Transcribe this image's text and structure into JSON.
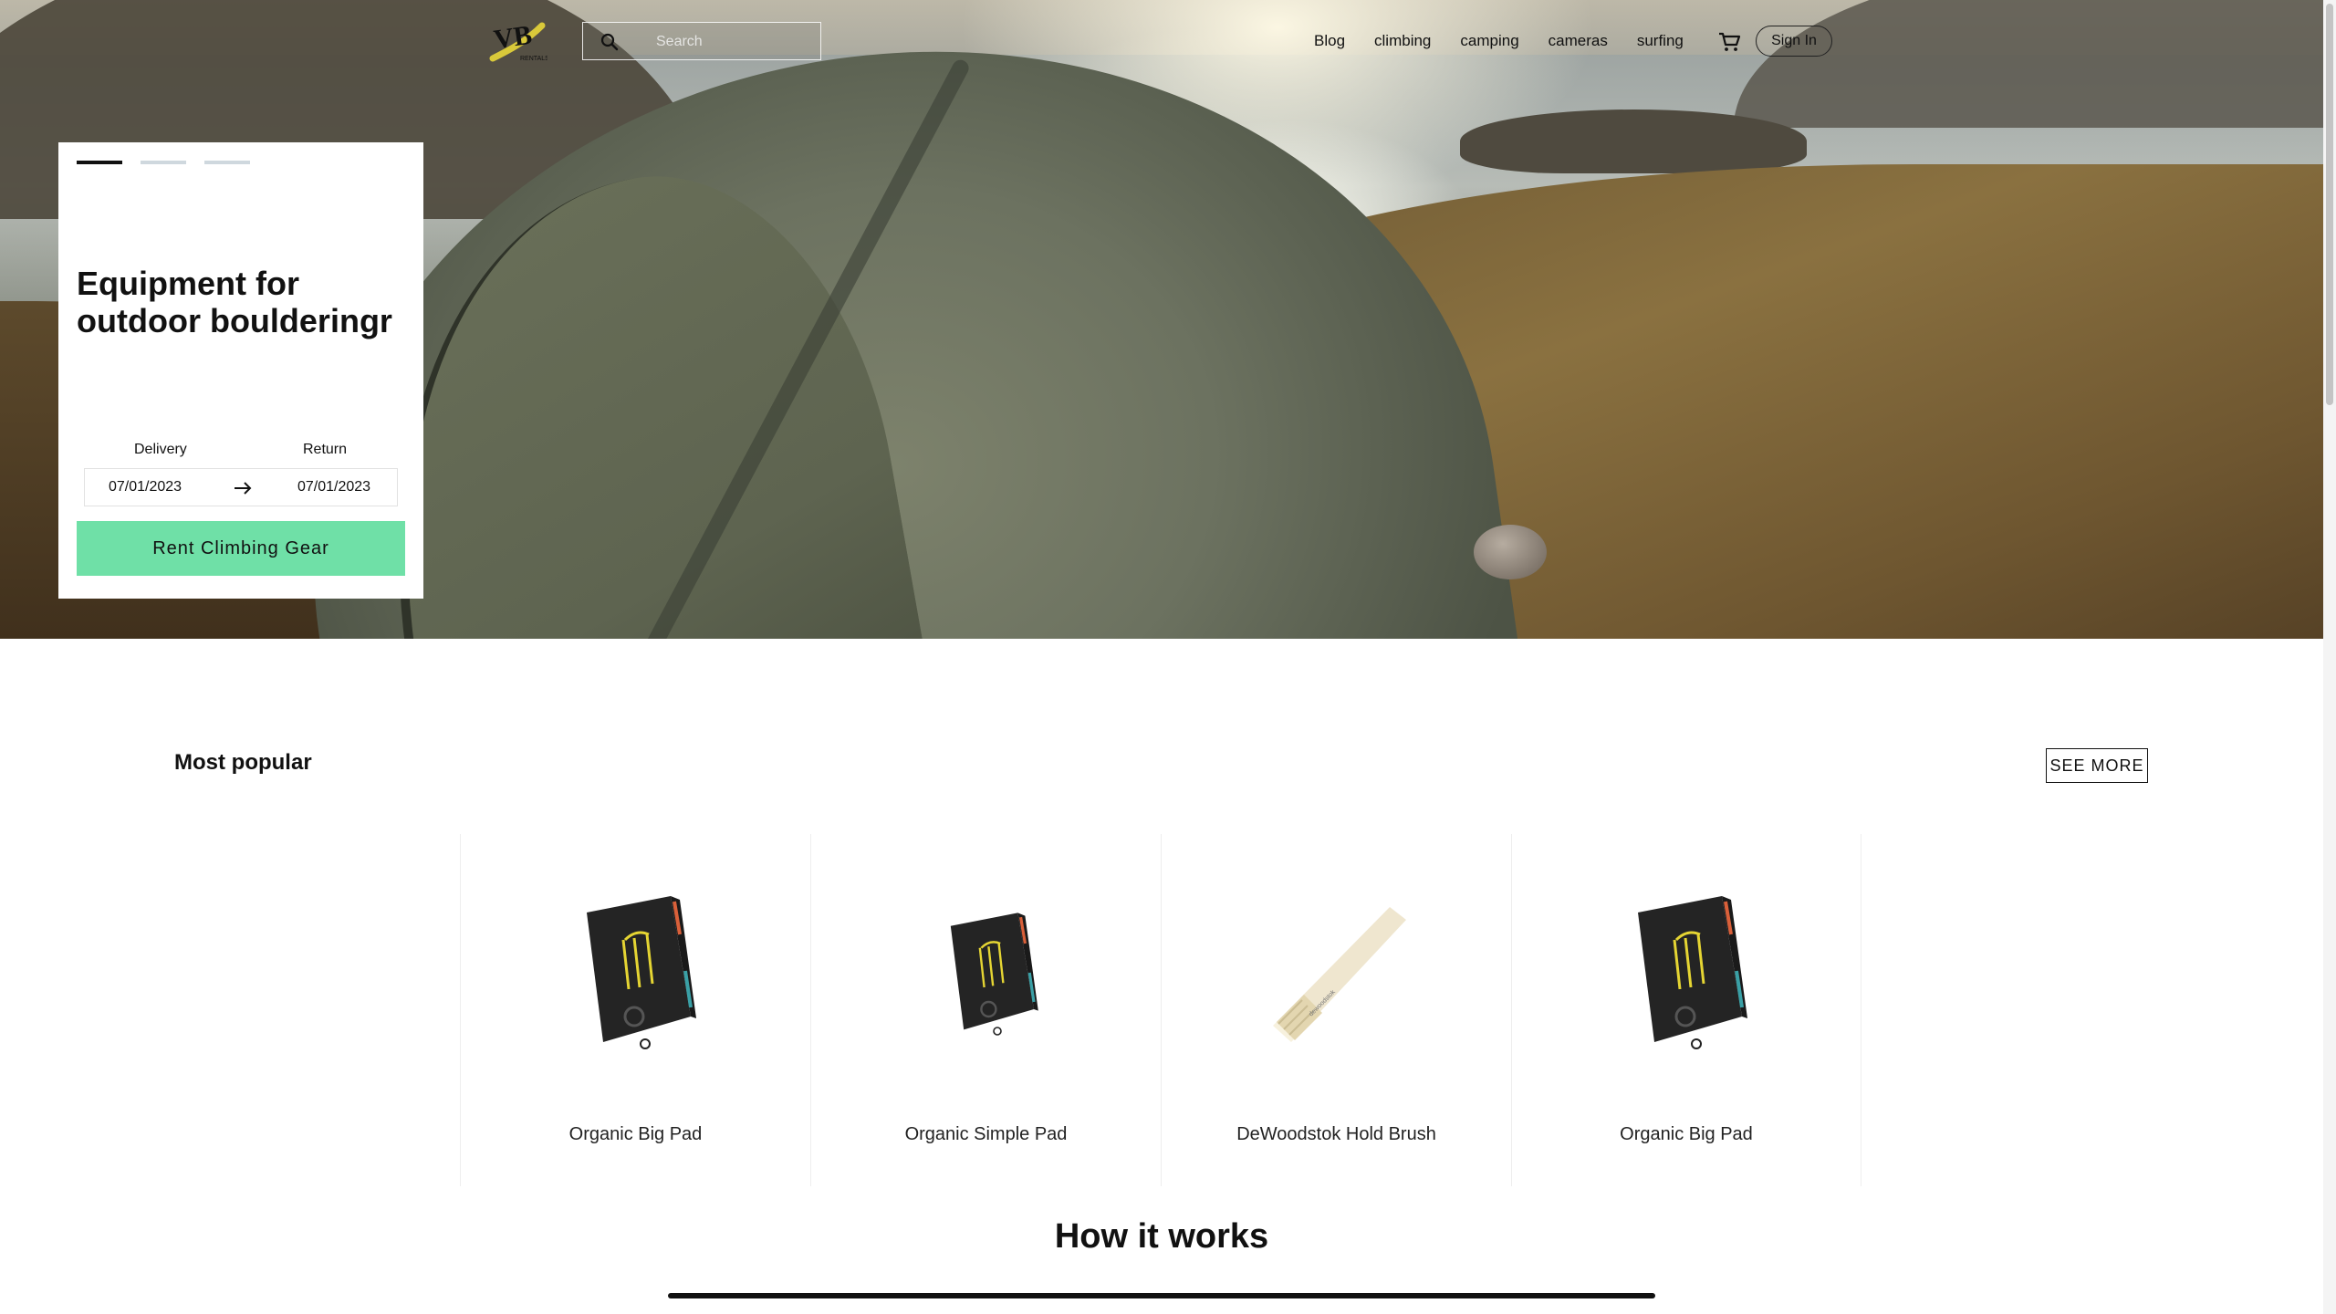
{
  "brand": {
    "logo_icon": "vib-rentals-logo",
    "logo_text": "VIB RENTALS"
  },
  "search": {
    "placeholder": "Search",
    "value": ""
  },
  "nav": {
    "links": [
      "Blog",
      "climbing",
      "camping",
      "cameras",
      "surfing"
    ],
    "cart_icon": "cart-icon",
    "signin_label": "Sign In"
  },
  "hero": {
    "slides_total": 3,
    "active_slide": 1,
    "title_line1": "Equipment for",
    "title_line2": "outdoor boulderingr",
    "delivery_label": "Delivery",
    "return_label": "Return",
    "delivery_date": "07/01/2023",
    "return_date": "07/01/2023",
    "cta_label": "Rent Climbing Gear",
    "cta_color": "#6fe0a7"
  },
  "popular": {
    "title": "Most popular",
    "see_more_label": "SEE MORE",
    "products": [
      {
        "name": "Organic Big Pad",
        "image": "crash-pad"
      },
      {
        "name": "Organic Simple Pad",
        "image": "crash-pad"
      },
      {
        "name": "DeWoodstok Hold Brush",
        "image": "brush"
      },
      {
        "name": "Organic Big Pad",
        "image": "crash-pad"
      }
    ]
  },
  "how": {
    "title": "How it works"
  }
}
